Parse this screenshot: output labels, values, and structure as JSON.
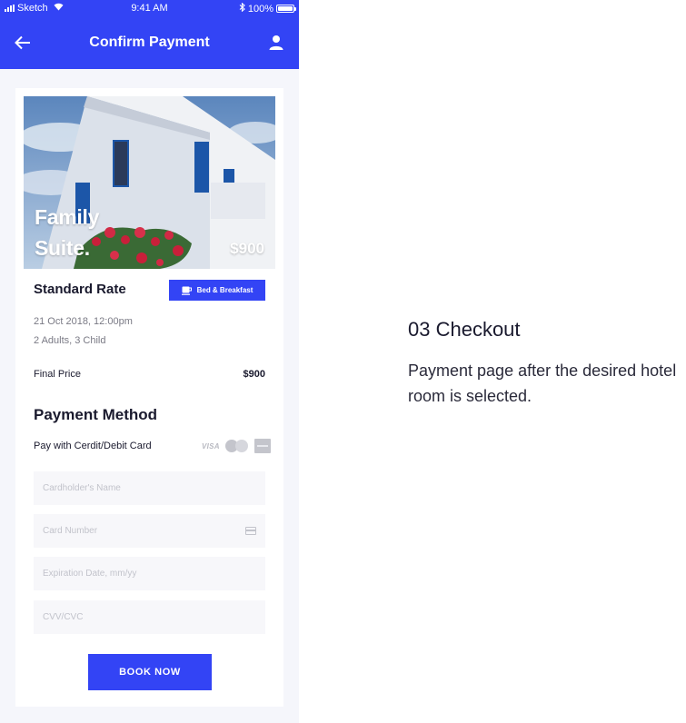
{
  "status_bar": {
    "carrier": "Sketch",
    "time": "9:41 AM",
    "battery": "100%"
  },
  "header": {
    "title": "Confirm Payment",
    "back_icon": "arrow-left-icon",
    "profile_icon": "user-icon"
  },
  "room": {
    "name_line1": "Family",
    "name_line2": "Suite.",
    "price": "$900",
    "rate_name": "Standard Rate",
    "badge_label": "Bed & Breakfast",
    "badge_icon": "coffee-cup-icon",
    "date": "21 Oct 2018, 12:00pm",
    "guests": "2 Adults, 3 Child",
    "final_price_label": "Final Price",
    "final_price_value": "$900"
  },
  "payment": {
    "title": "Payment Method",
    "card_option_label": "Pay with Cerdit/Debit Card",
    "card_brands": [
      "VISA",
      "mastercard",
      "amex"
    ],
    "fields": {
      "cardholder": "Cardholder's Name",
      "card_number": "Card Number",
      "expiration": "Expiration Date, mm/yy",
      "cvv": "CVV/CVC"
    },
    "book_button": "BOOK NOW"
  },
  "description": {
    "title": "03 Checkout",
    "text": "Payment page after the desired hotel room is selected."
  },
  "colors": {
    "accent": "#3344f5",
    "background": "#f5f6fb",
    "field_bg": "#f7f7fa"
  }
}
